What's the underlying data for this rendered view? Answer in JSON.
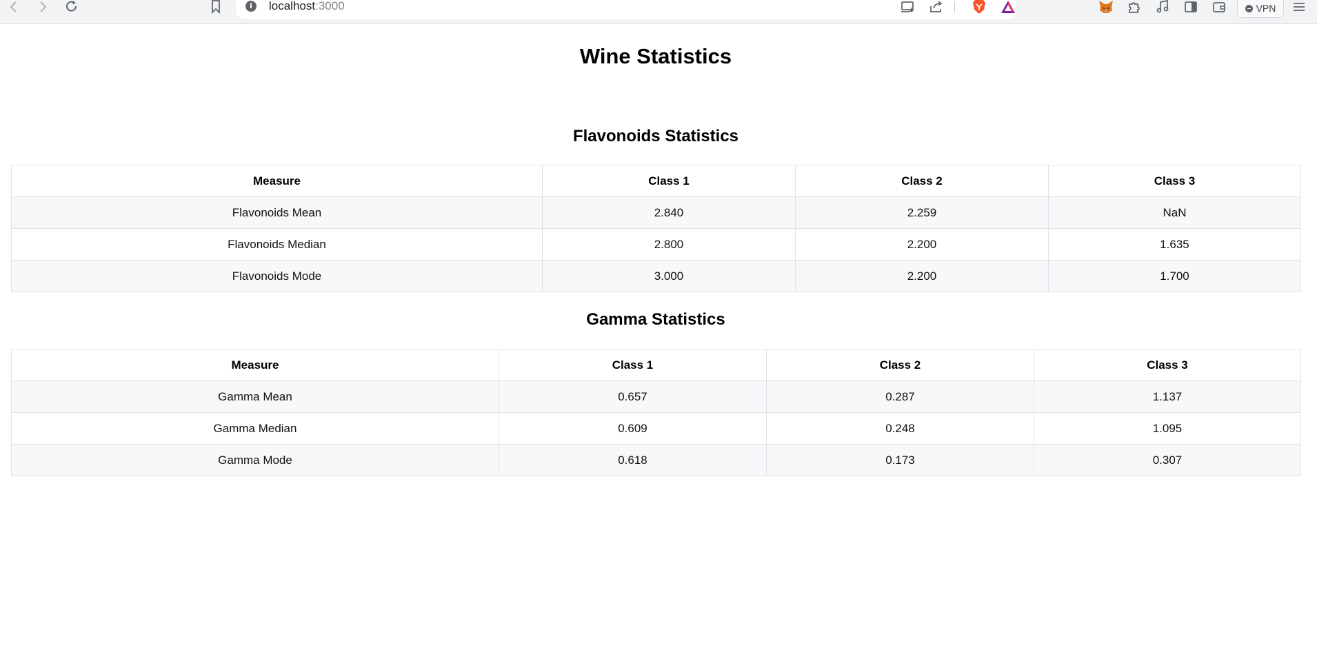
{
  "browser": {
    "url_host": "localhost",
    "url_port": ":3000",
    "vpn_label": "VPN"
  },
  "page": {
    "title": "Wine Statistics"
  },
  "flavonoids": {
    "title": "Flavonoids Statistics",
    "headers": [
      "Measure",
      "Class 1",
      "Class 2",
      "Class 3"
    ],
    "rows": [
      [
        "Flavonoids Mean",
        "2.840",
        "2.259",
        "NaN"
      ],
      [
        "Flavonoids Median",
        "2.800",
        "2.200",
        "1.635"
      ],
      [
        "Flavonoids Mode",
        "3.000",
        "2.200",
        "1.700"
      ]
    ]
  },
  "gamma": {
    "title": "Gamma Statistics",
    "headers": [
      "Measure",
      "Class 1",
      "Class 2",
      "Class 3"
    ],
    "rows": [
      [
        "Gamma Mean",
        "0.657",
        "0.287",
        "1.137"
      ],
      [
        "Gamma Median",
        "0.609",
        "0.248",
        "1.095"
      ],
      [
        "Gamma Mode",
        "0.618",
        "0.173",
        "0.307"
      ]
    ]
  },
  "icons": {
    "back": "chevron-left-icon",
    "forward": "chevron-right-icon",
    "reload": "reload-icon",
    "bookmark": "bookmark-icon",
    "site_info": "info-icon",
    "cast": "cast-icon",
    "share": "share-icon",
    "brave_shields": "brave-lion-icon",
    "brave_rewards": "triangle-icon",
    "metamask": "fox-icon",
    "extensions": "puzzle-icon",
    "media": "music-note-icon",
    "sidebar": "sidebar-icon",
    "wallet": "wallet-icon",
    "menu": "hamburger-icon"
  },
  "colors": {
    "brave_orange": "#fb542b",
    "rewards_purple": "#a020a0",
    "table_stripe": "#f7f8fa",
    "table_border": "#dee2e6"
  }
}
